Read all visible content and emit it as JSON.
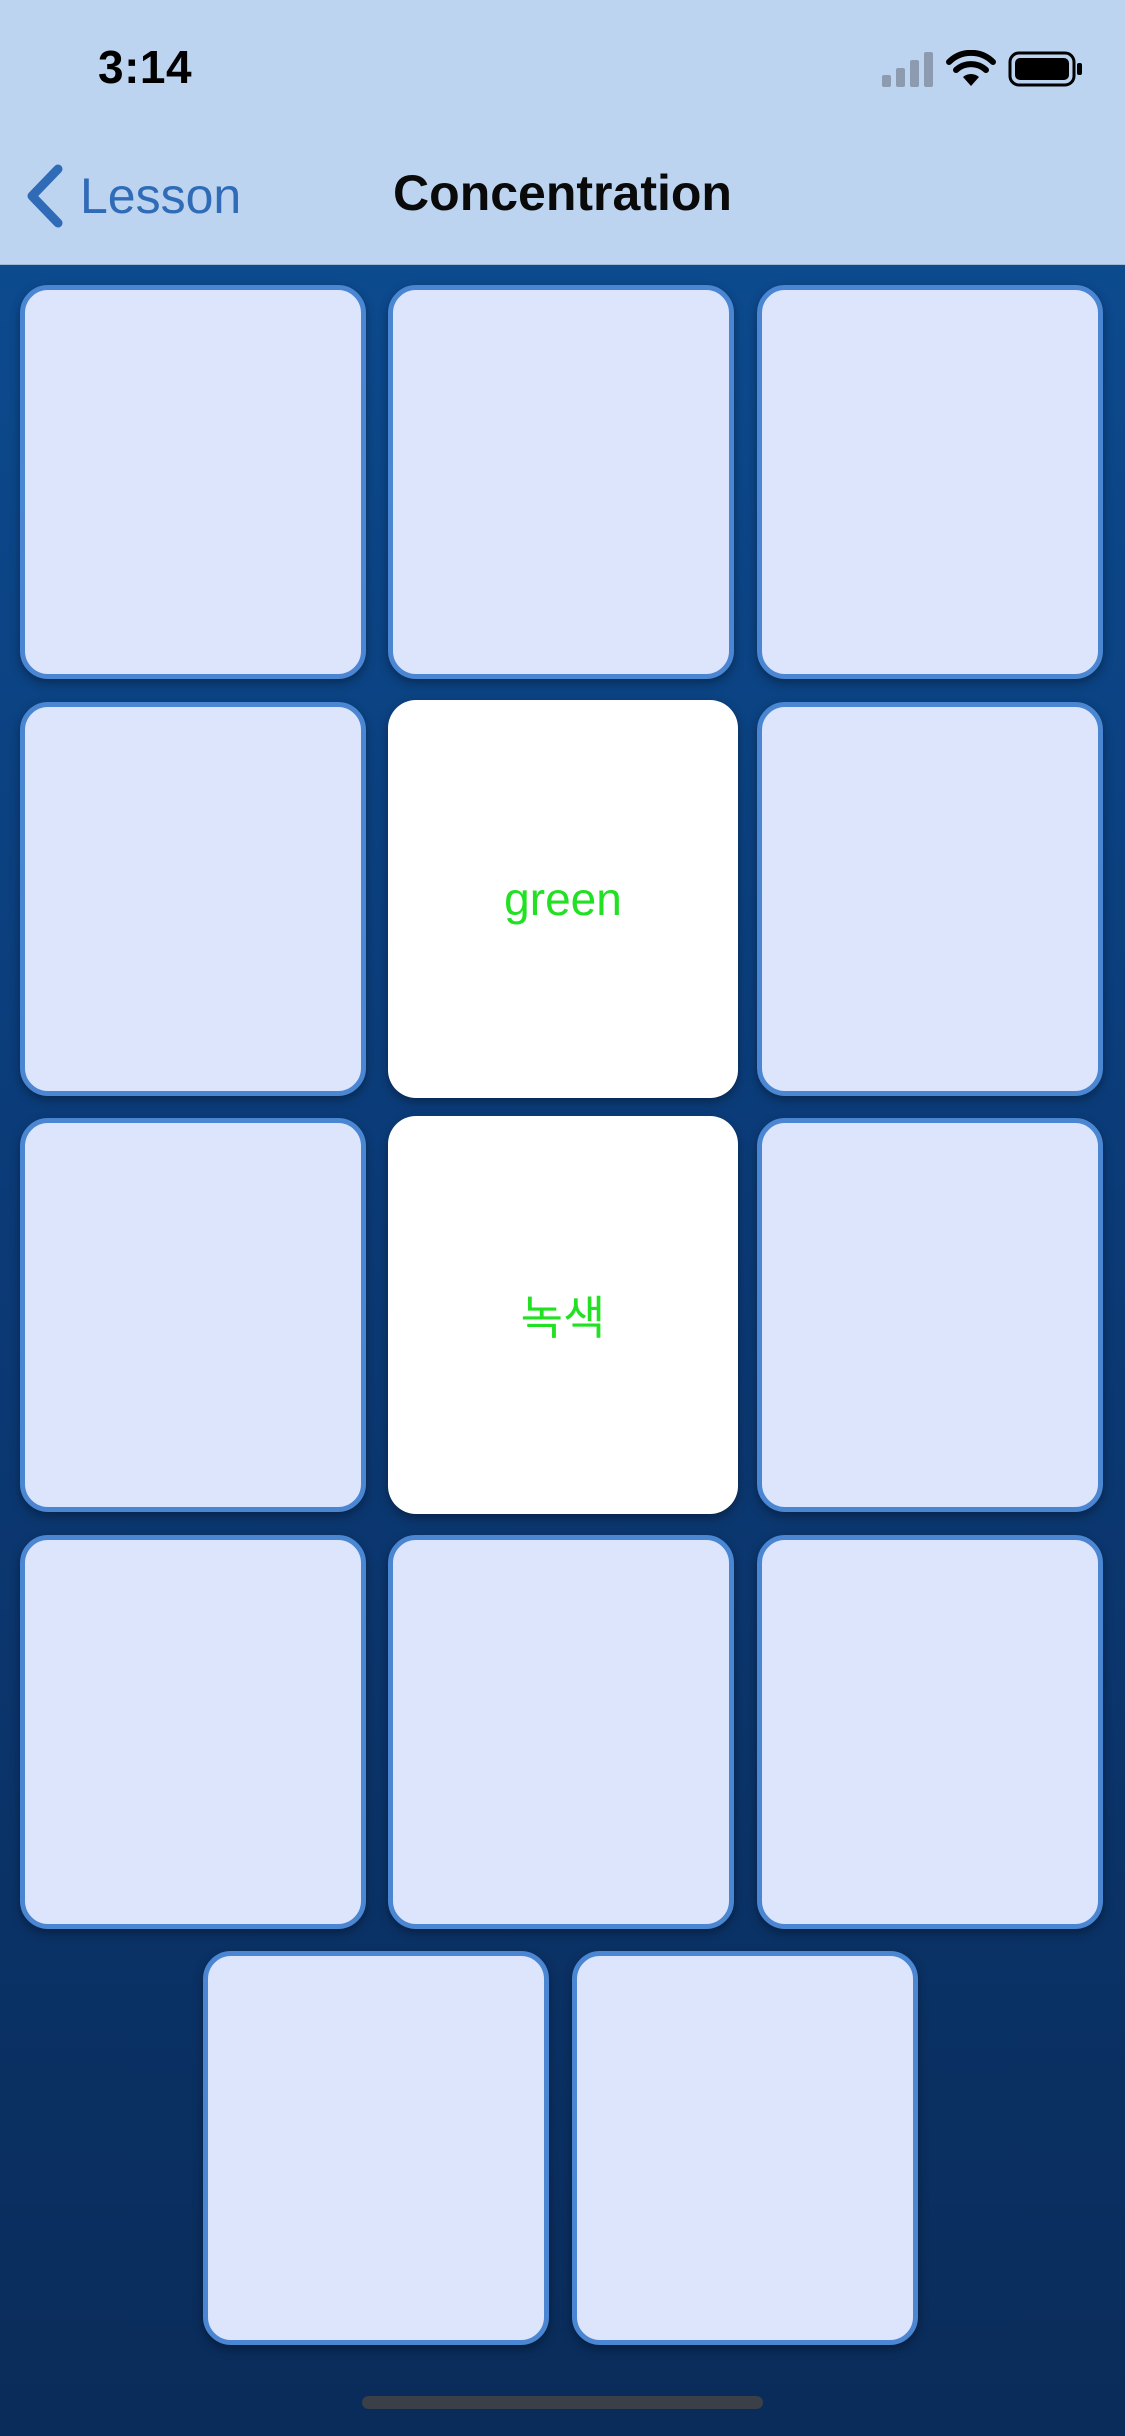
{
  "status_bar": {
    "time": "3:14",
    "icons": [
      "cellular-signal-icon",
      "wifi-icon",
      "battery-icon"
    ]
  },
  "nav": {
    "back_label": "Lesson",
    "back_icon": "chevron-left-icon",
    "title": "Concentration"
  },
  "colors": {
    "accent": "#2f6bb6",
    "card_back": "#dde5fd",
    "card_border": "#4a86d2",
    "card_face": "#ffffff",
    "card_text": "#22e022",
    "background_top": "#0c4a8e",
    "background_bottom": "#0a2c5a"
  },
  "cards": [
    {
      "state": "face-down",
      "text": ""
    },
    {
      "state": "face-down",
      "text": ""
    },
    {
      "state": "face-down",
      "text": ""
    },
    {
      "state": "face-down",
      "text": ""
    },
    {
      "state": "face-up",
      "text": "green"
    },
    {
      "state": "face-down",
      "text": ""
    },
    {
      "state": "face-down",
      "text": ""
    },
    {
      "state": "face-up",
      "text": "녹색"
    },
    {
      "state": "face-down",
      "text": ""
    },
    {
      "state": "face-down",
      "text": ""
    },
    {
      "state": "face-down",
      "text": ""
    },
    {
      "state": "face-down",
      "text": ""
    },
    {
      "state": "face-down",
      "text": ""
    },
    {
      "state": "face-down",
      "text": ""
    }
  ]
}
